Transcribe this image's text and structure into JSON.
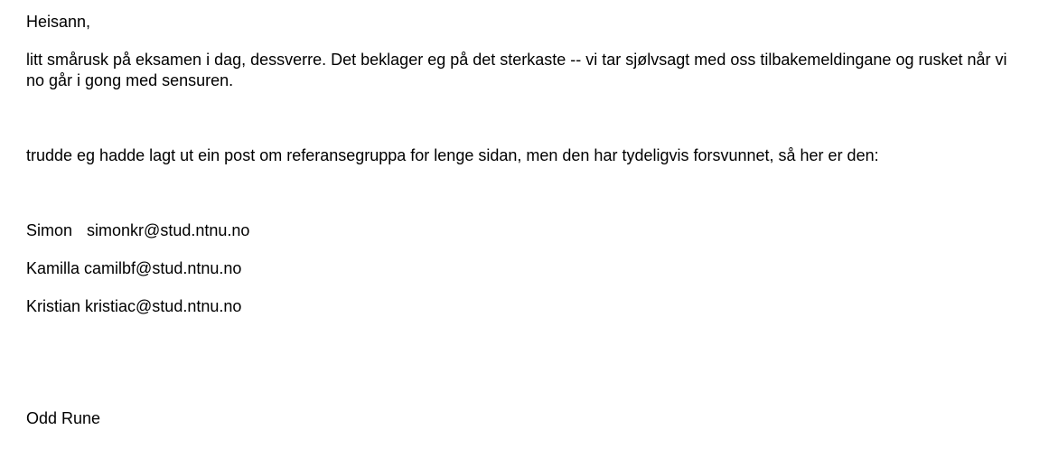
{
  "message": {
    "greeting": "Heisann,",
    "apology_line_1": "litt smårusk på eksamen i dag, dessverre. Det beklager eg på det sterkaste -- vi tar sjølvsagt med oss tilbakemeldingane og rusket når vi",
    "apology_line_2": "no går i gong med sensuren.",
    "reference_group_intro": "trudde eg hadde lagt ut ein post om referansegruppa for lenge sidan, men den har tydeligvis forsvunnet, så her er den:",
    "contacts": [
      {
        "name": "Simon",
        "email": "simonkr@stud.ntnu.no"
      },
      {
        "name": "Kamilla",
        "email": "camilbf@stud.ntnu.no"
      },
      {
        "name": "Kristian",
        "email": "kristiac@stud.ntnu.no"
      }
    ],
    "signature": "Odd Rune"
  }
}
